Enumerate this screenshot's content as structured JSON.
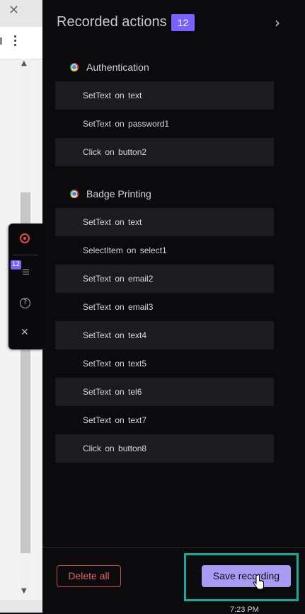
{
  "header": {
    "title": "Recorded actions",
    "count": "12"
  },
  "groups": [
    {
      "name": "Authentication",
      "actions": [
        {
          "label": "SetText on text"
        },
        {
          "label": "SetText on password1"
        },
        {
          "label": "Click on button2"
        }
      ]
    },
    {
      "name": "Badge Printing",
      "actions": [
        {
          "label": "SetText on text"
        },
        {
          "label": "SelectItem on select1"
        },
        {
          "label": "SetText on email2"
        },
        {
          "label": "SetText on email3"
        },
        {
          "label": "SetText on text4"
        },
        {
          "label": "SetText on text5"
        },
        {
          "label": "SetText on tel6"
        },
        {
          "label": "SetText on text7"
        },
        {
          "label": "Click on button8"
        }
      ]
    }
  ],
  "toolbar": {
    "badge": "12"
  },
  "footer": {
    "delete_label": "Delete all",
    "save_label": "Save recording"
  },
  "taskbar": {
    "time": "7:23 PM"
  },
  "colors": {
    "accent": "#7b61ff",
    "danger": "#e06469",
    "save_bg": "#a99af4",
    "highlight": "#15a99a"
  },
  "icons": [
    "close-icon",
    "kebab-menu-icon",
    "record-icon",
    "list-icon",
    "help-icon",
    "chrome-icon",
    "chevron-right-icon",
    "cursor-icon"
  ]
}
